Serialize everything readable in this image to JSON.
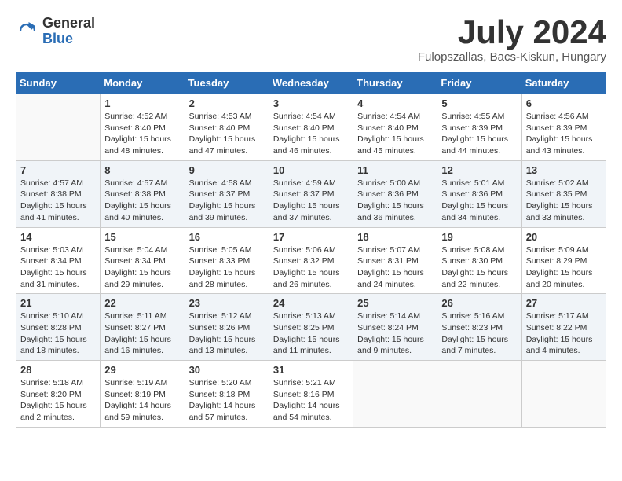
{
  "header": {
    "logo_general": "General",
    "logo_blue": "Blue",
    "month_title": "July 2024",
    "subtitle": "Fulopszallas, Bacs-Kiskun, Hungary"
  },
  "days_of_week": [
    "Sunday",
    "Monday",
    "Tuesday",
    "Wednesday",
    "Thursday",
    "Friday",
    "Saturday"
  ],
  "weeks": [
    [
      {
        "day": "",
        "info": ""
      },
      {
        "day": "1",
        "info": "Sunrise: 4:52 AM\nSunset: 8:40 PM\nDaylight: 15 hours\nand 48 minutes."
      },
      {
        "day": "2",
        "info": "Sunrise: 4:53 AM\nSunset: 8:40 PM\nDaylight: 15 hours\nand 47 minutes."
      },
      {
        "day": "3",
        "info": "Sunrise: 4:54 AM\nSunset: 8:40 PM\nDaylight: 15 hours\nand 46 minutes."
      },
      {
        "day": "4",
        "info": "Sunrise: 4:54 AM\nSunset: 8:40 PM\nDaylight: 15 hours\nand 45 minutes."
      },
      {
        "day": "5",
        "info": "Sunrise: 4:55 AM\nSunset: 8:39 PM\nDaylight: 15 hours\nand 44 minutes."
      },
      {
        "day": "6",
        "info": "Sunrise: 4:56 AM\nSunset: 8:39 PM\nDaylight: 15 hours\nand 43 minutes."
      }
    ],
    [
      {
        "day": "7",
        "info": "Sunrise: 4:57 AM\nSunset: 8:38 PM\nDaylight: 15 hours\nand 41 minutes."
      },
      {
        "day": "8",
        "info": "Sunrise: 4:57 AM\nSunset: 8:38 PM\nDaylight: 15 hours\nand 40 minutes."
      },
      {
        "day": "9",
        "info": "Sunrise: 4:58 AM\nSunset: 8:37 PM\nDaylight: 15 hours\nand 39 minutes."
      },
      {
        "day": "10",
        "info": "Sunrise: 4:59 AM\nSunset: 8:37 PM\nDaylight: 15 hours\nand 37 minutes."
      },
      {
        "day": "11",
        "info": "Sunrise: 5:00 AM\nSunset: 8:36 PM\nDaylight: 15 hours\nand 36 minutes."
      },
      {
        "day": "12",
        "info": "Sunrise: 5:01 AM\nSunset: 8:36 PM\nDaylight: 15 hours\nand 34 minutes."
      },
      {
        "day": "13",
        "info": "Sunrise: 5:02 AM\nSunset: 8:35 PM\nDaylight: 15 hours\nand 33 minutes."
      }
    ],
    [
      {
        "day": "14",
        "info": "Sunrise: 5:03 AM\nSunset: 8:34 PM\nDaylight: 15 hours\nand 31 minutes."
      },
      {
        "day": "15",
        "info": "Sunrise: 5:04 AM\nSunset: 8:34 PM\nDaylight: 15 hours\nand 29 minutes."
      },
      {
        "day": "16",
        "info": "Sunrise: 5:05 AM\nSunset: 8:33 PM\nDaylight: 15 hours\nand 28 minutes."
      },
      {
        "day": "17",
        "info": "Sunrise: 5:06 AM\nSunset: 8:32 PM\nDaylight: 15 hours\nand 26 minutes."
      },
      {
        "day": "18",
        "info": "Sunrise: 5:07 AM\nSunset: 8:31 PM\nDaylight: 15 hours\nand 24 minutes."
      },
      {
        "day": "19",
        "info": "Sunrise: 5:08 AM\nSunset: 8:30 PM\nDaylight: 15 hours\nand 22 minutes."
      },
      {
        "day": "20",
        "info": "Sunrise: 5:09 AM\nSunset: 8:29 PM\nDaylight: 15 hours\nand 20 minutes."
      }
    ],
    [
      {
        "day": "21",
        "info": "Sunrise: 5:10 AM\nSunset: 8:28 PM\nDaylight: 15 hours\nand 18 minutes."
      },
      {
        "day": "22",
        "info": "Sunrise: 5:11 AM\nSunset: 8:27 PM\nDaylight: 15 hours\nand 16 minutes."
      },
      {
        "day": "23",
        "info": "Sunrise: 5:12 AM\nSunset: 8:26 PM\nDaylight: 15 hours\nand 13 minutes."
      },
      {
        "day": "24",
        "info": "Sunrise: 5:13 AM\nSunset: 8:25 PM\nDaylight: 15 hours\nand 11 minutes."
      },
      {
        "day": "25",
        "info": "Sunrise: 5:14 AM\nSunset: 8:24 PM\nDaylight: 15 hours\nand 9 minutes."
      },
      {
        "day": "26",
        "info": "Sunrise: 5:16 AM\nSunset: 8:23 PM\nDaylight: 15 hours\nand 7 minutes."
      },
      {
        "day": "27",
        "info": "Sunrise: 5:17 AM\nSunset: 8:22 PM\nDaylight: 15 hours\nand 4 minutes."
      }
    ],
    [
      {
        "day": "28",
        "info": "Sunrise: 5:18 AM\nSunset: 8:20 PM\nDaylight: 15 hours\nand 2 minutes."
      },
      {
        "day": "29",
        "info": "Sunrise: 5:19 AM\nSunset: 8:19 PM\nDaylight: 14 hours\nand 59 minutes."
      },
      {
        "day": "30",
        "info": "Sunrise: 5:20 AM\nSunset: 8:18 PM\nDaylight: 14 hours\nand 57 minutes."
      },
      {
        "day": "31",
        "info": "Sunrise: 5:21 AM\nSunset: 8:16 PM\nDaylight: 14 hours\nand 54 minutes."
      },
      {
        "day": "",
        "info": ""
      },
      {
        "day": "",
        "info": ""
      },
      {
        "day": "",
        "info": ""
      }
    ]
  ]
}
